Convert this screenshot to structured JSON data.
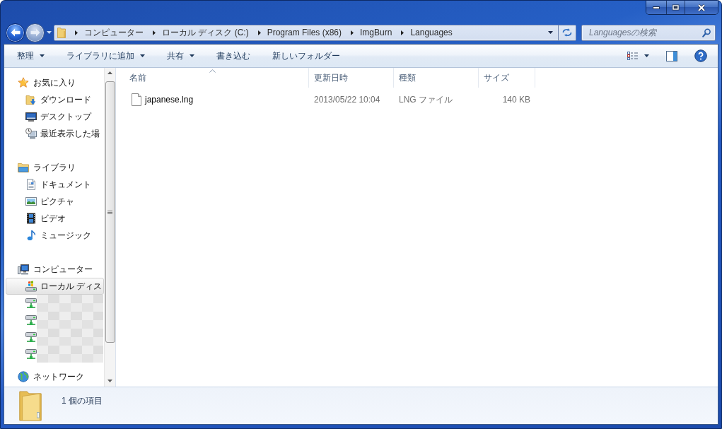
{
  "address_bar": {
    "breadcrumbs": [
      "コンピューター",
      "ローカル ディスク (C:)",
      "Program Files (x86)",
      "ImgBurn",
      "Languages"
    ]
  },
  "search": {
    "placeholder": "Languagesの検索"
  },
  "toolbar": {
    "buttons": [
      {
        "label": "整理",
        "has_menu": true
      },
      {
        "label": "ライブラリに追加",
        "has_menu": true
      },
      {
        "label": "共有",
        "has_menu": true
      },
      {
        "label": "書き込む",
        "has_menu": false
      },
      {
        "label": "新しいフォルダー",
        "has_menu": false
      }
    ]
  },
  "nav_pane": {
    "groups": [
      {
        "kind": "star",
        "label": "お気に入り",
        "selected": false,
        "children": [
          {
            "kind": "downloads",
            "label": "ダウンロード",
            "selected": false
          },
          {
            "kind": "desktop",
            "label": "デスクトップ",
            "selected": false
          },
          {
            "kind": "recent",
            "label": "最近表示した場",
            "selected": false
          }
        ]
      },
      {
        "kind": "library",
        "label": "ライブラリ",
        "selected": false,
        "children": [
          {
            "kind": "documents",
            "label": "ドキュメント",
            "selected": false
          },
          {
            "kind": "pictures",
            "label": "ピクチャ",
            "selected": false
          },
          {
            "kind": "videos",
            "label": "ビデオ",
            "selected": false
          },
          {
            "kind": "music",
            "label": "ミュージック",
            "selected": false
          }
        ]
      },
      {
        "kind": "computer",
        "label": "コンピューター",
        "selected": false,
        "children": [
          {
            "kind": "disk",
            "label": "ローカル ディス",
            "selected": true
          },
          {
            "kind": "netdrive",
            "selected": false
          },
          {
            "kind": "netdrive",
            "selected": false
          },
          {
            "kind": "netdrive",
            "selected": false
          },
          {
            "kind": "netdrive",
            "selected": false
          }
        ]
      },
      {
        "kind": "network",
        "label": "ネットワーク",
        "selected": false
      }
    ]
  },
  "file_list": {
    "columns": [
      {
        "label": "名前",
        "sorted": true
      },
      {
        "label": "更新日時",
        "sorted": false
      },
      {
        "label": "種類",
        "sorted": false
      },
      {
        "label": "サイズ",
        "sorted": false
      }
    ],
    "rows": [
      {
        "cells": [
          "japanese.lng",
          "2013/05/22 10:04",
          "LNG ファイル",
          "140 KB"
        ]
      }
    ]
  },
  "details_pane": {
    "summary": "1 個の項目"
  }
}
